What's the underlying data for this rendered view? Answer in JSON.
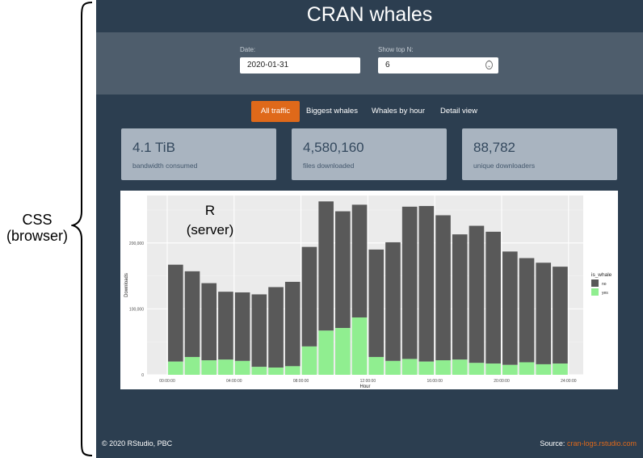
{
  "annotation": {
    "css_line1": "CSS",
    "css_line2": "(browser)",
    "r_line1": "R",
    "r_line2": "(server)"
  },
  "app": {
    "title": "CRAN whales",
    "date_label": "Date:",
    "date_value": "2020-01-31",
    "topn_label": "Show top N:",
    "topn_value": "6",
    "tabs": [
      {
        "label": "All traffic",
        "active": true
      },
      {
        "label": "Biggest whales",
        "active": false
      },
      {
        "label": "Whales by hour",
        "active": false
      },
      {
        "label": "Detail view",
        "active": false
      }
    ],
    "cards": [
      {
        "value": "4.1 TiB",
        "caption": "bandwidth consumed"
      },
      {
        "value": "4,580,160",
        "caption": "files downloaded"
      },
      {
        "value": "88,782",
        "caption": "unique downloaders"
      }
    ],
    "footer_left": "© 2020 RStudio, PBC",
    "footer_source_label": "Source:",
    "footer_source_link": "cran-logs.rstudio.com"
  },
  "colors": {
    "background": "#2c3e50",
    "panel": "#4e5d6c",
    "accent": "#df691a",
    "card": "#a9b4c0",
    "bar_no": "#595959",
    "bar_yes": "#90ee90"
  },
  "chart_data": {
    "type": "bar",
    "stacked": true,
    "xlabel": "Hour",
    "ylabel": "Downloads",
    "x_ticks": [
      "00:00:00",
      "04:00:00",
      "08:00:00",
      "12:00:00",
      "16:00:00",
      "20:00:00",
      "24:00:00"
    ],
    "y_ticks": [
      "0",
      "100,000",
      "200,000"
    ],
    "ylim": [
      0,
      272000
    ],
    "legend_title": "is_whale",
    "legend_placement": "right",
    "categories": [
      0,
      1,
      2,
      3,
      4,
      5,
      6,
      7,
      8,
      9,
      10,
      11,
      12,
      13,
      14,
      15,
      16,
      17,
      18,
      19,
      20,
      21,
      22,
      23
    ],
    "series": [
      {
        "name": "no",
        "values": [
          147000,
          130000,
          117000,
          103000,
          104000,
          110000,
          122000,
          128000,
          151000,
          196000,
          177000,
          171000,
          163000,
          180000,
          231000,
          236000,
          220000,
          190000,
          208000,
          200000,
          172000,
          158000,
          154000,
          147000
        ]
      },
      {
        "name": "yes",
        "values": [
          20000,
          27000,
          22000,
          23000,
          21000,
          12000,
          11000,
          13000,
          43000,
          67000,
          71000,
          87000,
          27000,
          21000,
          24000,
          20000,
          22000,
          23000,
          18000,
          17000,
          15000,
          19000,
          16000,
          17000
        ]
      }
    ]
  }
}
